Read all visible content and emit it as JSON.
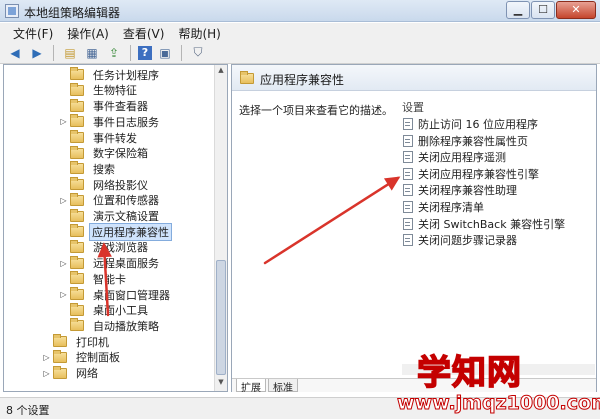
{
  "window": {
    "title": "本地组策略编辑器",
    "min": "▁",
    "max": "☐",
    "close": "✕"
  },
  "menu": [
    "文件(F)",
    "操作(A)",
    "查看(V)",
    "帮助(H)"
  ],
  "toolbar": {
    "back_icon": "arrow-left-icon",
    "forward_icon": "arrow-right-icon",
    "glyphs": [
      "◀",
      "▶",
      "▤",
      "▦",
      "⇪",
      "?",
      "▣",
      "⛉"
    ]
  },
  "tree": {
    "items": [
      {
        "label": "任务计划程序",
        "expander": ""
      },
      {
        "label": "生物特征",
        "expander": ""
      },
      {
        "label": "事件查看器",
        "expander": ""
      },
      {
        "label": "事件日志服务",
        "expander": "▷"
      },
      {
        "label": "事件转发",
        "expander": ""
      },
      {
        "label": "数字保险箱",
        "expander": ""
      },
      {
        "label": "搜索",
        "expander": ""
      },
      {
        "label": "网络投影仪",
        "expander": ""
      },
      {
        "label": "位置和传感器",
        "expander": "▷"
      },
      {
        "label": "演示文稿设置",
        "expander": ""
      },
      {
        "label": "应用程序兼容性",
        "expander": "",
        "selected": true
      },
      {
        "label": "游戏浏览器",
        "expander": ""
      },
      {
        "label": "远程桌面服务",
        "expander": "▷"
      },
      {
        "label": "智能卡",
        "expander": ""
      },
      {
        "label": "桌面窗口管理器",
        "expander": "▷"
      },
      {
        "label": "桌面小工具",
        "expander": ""
      },
      {
        "label": "自动播放策略",
        "expander": ""
      },
      {
        "label": "打印机",
        "expander": ""
      },
      {
        "label": "控制面板",
        "expander": "▷"
      },
      {
        "label": "网络",
        "expander": "▷"
      }
    ]
  },
  "right_pane": {
    "title": "应用程序兼容性",
    "description": "选择一个项目来查看它的描述。",
    "column_header": "设置",
    "settings": [
      "防止访问 16 位应用程序",
      "删除程序兼容性属性页",
      "关闭应用程序遥测",
      "关闭应用程序兼容性引擎",
      "关闭程序兼容性助理",
      "关闭程序清单",
      "关闭 SwitchBack 兼容性引擎",
      "关闭问题步骤记录器"
    ],
    "tabs": [
      "扩展",
      "标准"
    ]
  },
  "status": {
    "text": "8 个设置"
  },
  "annotation": {
    "color": "#d9342b"
  },
  "watermark": {
    "title": "学知网",
    "url": "www.jmqz1000.com"
  }
}
